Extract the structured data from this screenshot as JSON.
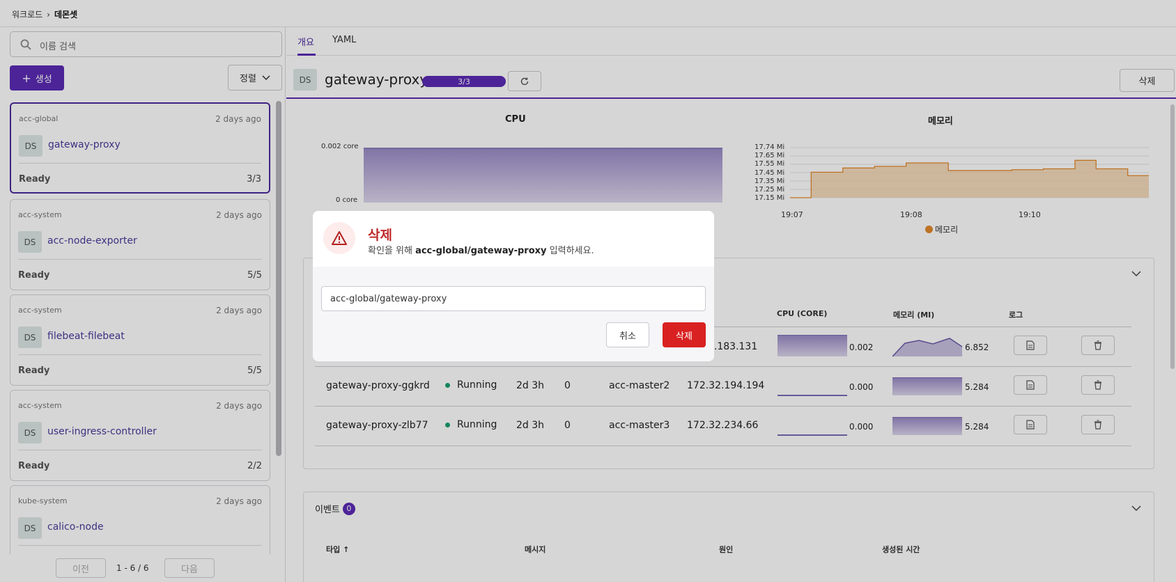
{
  "breadcrumb": {
    "parent": "워크로드",
    "current": "데몬셋"
  },
  "sidebar": {
    "search_placeholder": "이름 검색",
    "create_label": "생성",
    "sort_label": "정렬",
    "items": [
      {
        "namespace": "acc-global",
        "age": "2 days ago",
        "kind": "DS",
        "name": "gateway-proxy",
        "status": "Ready",
        "count": "3/3",
        "selected": true
      },
      {
        "namespace": "acc-system",
        "age": "2 days ago",
        "kind": "DS",
        "name": "acc-node-exporter",
        "status": "Ready",
        "count": "5/5"
      },
      {
        "namespace": "acc-system",
        "age": "2 days ago",
        "kind": "DS",
        "name": "filebeat-filebeat",
        "status": "Ready",
        "count": "5/5"
      },
      {
        "namespace": "acc-system",
        "age": "2 days ago",
        "kind": "DS",
        "name": "user-ingress-controller",
        "status": "Ready",
        "count": "2/2"
      },
      {
        "namespace": "kube-system",
        "age": "2 days ago",
        "kind": "DS",
        "name": "calico-node"
      }
    ],
    "pagination": {
      "prev": "이전",
      "range": "1 - 6 / 6",
      "next": "다음"
    }
  },
  "tabs": [
    {
      "label": "개요",
      "active": true
    },
    {
      "label": "YAML"
    }
  ],
  "detail": {
    "kind": "DS",
    "title": "gateway-proxy",
    "ready": "3/3",
    "ready_fraction": 1.0,
    "delete_label": "삭제"
  },
  "charts": {
    "cpu": {
      "title": "CPU",
      "yticks": [
        "0.002 core",
        "0 core"
      ]
    },
    "memory": {
      "title": "메모리",
      "yticks": [
        "17.74 Mi",
        "17.65 Mi",
        "17.55 Mi",
        "17.45 Mi",
        "17.35 Mi",
        "17.25 Mi",
        "17.15 Mi"
      ],
      "xticks": [
        "19:07",
        "19:08",
        "19:10"
      ],
      "legend": "메모리",
      "color": "#e38a2c"
    }
  },
  "chart_data": [
    {
      "type": "area",
      "title": "CPU",
      "ylim": [
        0,
        0.002
      ],
      "yticklabels": [
        "0.002 core",
        "0 core"
      ],
      "values": [
        0.002,
        0.002,
        0.002,
        0.002,
        0.002,
        0.002,
        0.002,
        0.002,
        0.002,
        0.002
      ]
    },
    {
      "type": "area",
      "title": "메모리",
      "ylim": [
        17.15,
        17.74
      ],
      "yticklabels": [
        "17.74 Mi",
        "17.65 Mi",
        "17.55 Mi",
        "17.45 Mi",
        "17.35 Mi",
        "17.25 Mi",
        "17.15 Mi"
      ],
      "xticklabels": [
        "19:07",
        "19:08",
        "19:10"
      ],
      "legend": [
        "메모리"
      ],
      "values": [
        17.15,
        17.15,
        17.45,
        17.45,
        17.45,
        17.5,
        17.5,
        17.5,
        17.52,
        17.52,
        17.52,
        17.56,
        17.56,
        17.56,
        17.56,
        17.47,
        17.47,
        17.47,
        17.47,
        17.47,
        17.47,
        17.48,
        17.48,
        17.48,
        17.49,
        17.49,
        17.49,
        17.59,
        17.59,
        17.49,
        17.49,
        17.49,
        17.41,
        17.41,
        17.41
      ]
    }
  ],
  "pods": {
    "headers": {
      "cpu": "CPU (CORE)",
      "memory": "메모리 (MI)",
      "log": "로그"
    },
    "rows": [
      {
        "name": "",
        "status": "",
        "age": "",
        "restarts": "",
        "node": "",
        "ip": "2.183.131",
        "cpu": "0.002",
        "memory": "6.852"
      },
      {
        "name": "gateway-proxy-ggkrd",
        "status": "Running",
        "age": "2d 3h",
        "restarts": "0",
        "node": "acc-master2",
        "ip": "172.32.194.194",
        "cpu": "0.000",
        "memory": "5.284"
      },
      {
        "name": "gateway-proxy-zlb77",
        "status": "Running",
        "age": "2d 3h",
        "restarts": "0",
        "node": "acc-master3",
        "ip": "172.32.234.66",
        "cpu": "0.000",
        "memory": "5.284"
      }
    ]
  },
  "events": {
    "title": "이벤트",
    "count": "0",
    "headers": {
      "type": "타입",
      "message": "메시지",
      "reason": "원인",
      "created": "생성된 시간"
    }
  },
  "dialog": {
    "title": "삭제",
    "subtitle_pre": "확인을 위해",
    "subtitle_target": "acc-global/gateway-proxy",
    "subtitle_post": "입력하세요.",
    "input_value": "acc-global/gateway-proxy",
    "cancel_label": "취소",
    "confirm_label": "삭제"
  }
}
